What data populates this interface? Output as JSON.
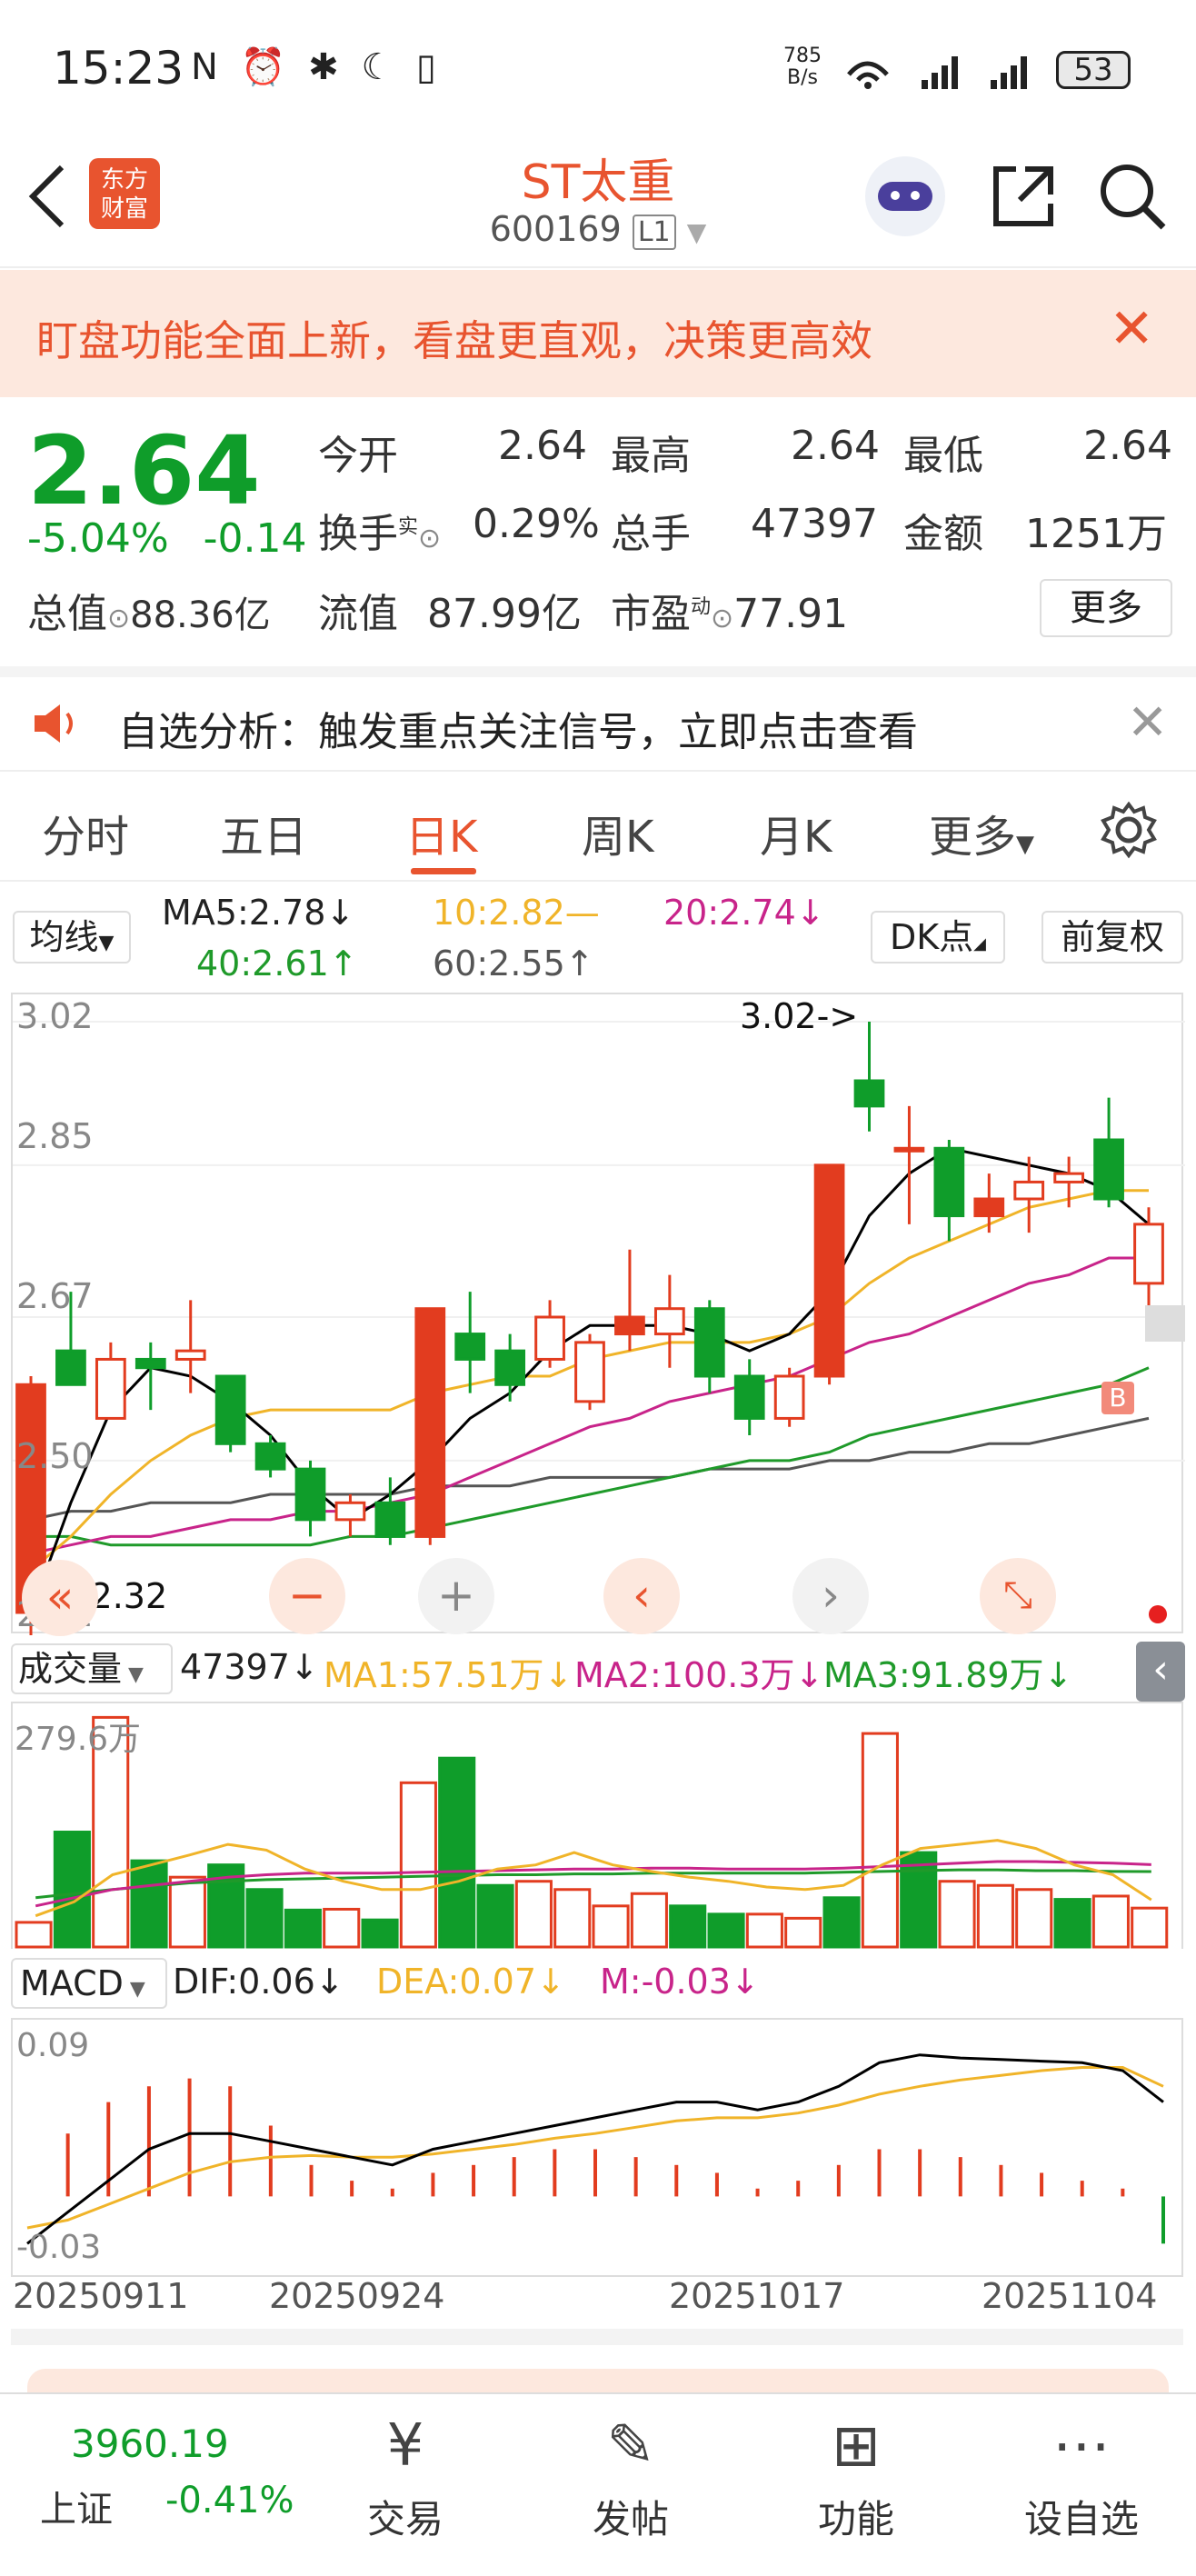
{
  "status_bar": {
    "time": "15:23",
    "icons": "N ⏰ ✱ ☾ ▯",
    "net_speed_value": "785",
    "net_speed_unit": "B/s",
    "battery": "53"
  },
  "header": {
    "brand_line1": "东方",
    "brand_line2": "财富",
    "stock_name": "ST太重",
    "stock_code": "600169",
    "level": "L1"
  },
  "banner": {
    "text": "盯盘功能全面上新，看盘更直观，决策更高效"
  },
  "quote": {
    "price": "2.64",
    "change_pct": "-5.04%",
    "change_amt": "-0.14",
    "open_label": "今开",
    "open": "2.64",
    "high_label": "最高",
    "high": "2.64",
    "low_label": "最低",
    "low": "2.64",
    "turnover_label": "换手",
    "turnover_sup": "实",
    "turnover": "0.29%",
    "volume_label": "总手",
    "volume": "47397",
    "amount_label": "金额",
    "amount": "1251万",
    "mktcap_label": "总值",
    "mktcap": "88.36亿",
    "float_label": "流值",
    "float": "87.99亿",
    "pe_label": "市盈",
    "pe_sup": "动",
    "pe": "77.91",
    "more_label": "更多"
  },
  "notice": {
    "text": "自选分析：触发重点关注信号，立即点击查看"
  },
  "tabs": [
    "分时",
    "五日",
    "日K",
    "周K",
    "月K",
    "更多"
  ],
  "kline": {
    "ma_select": "均线",
    "ma5": "MA5:2.78↓",
    "ma10": "10:2.82—",
    "ma20": "20:2.74↓",
    "ma40": "40:2.61↑",
    "ma60": "60:2.55↑",
    "dk_label": "DK点",
    "fq_label": "前复权",
    "y_labels": [
      "3.02",
      "2.85",
      "2.67",
      "2.50",
      "2.32"
    ],
    "high_marker": "3.02->",
    "low_marker": "<-2.32",
    "b_marker": "B"
  },
  "volume": {
    "select": "成交量",
    "value": "47397↓",
    "ma1": "MA1:57.51万↓",
    "ma2": "MA2:100.3万↓",
    "ma3": "MA3:91.89万↓",
    "top_label": "279.6万"
  },
  "macd": {
    "select": "MACD",
    "dif": "DIF:0.06↓",
    "dea": "DEA:0.07↓",
    "m": "M:-0.03↓",
    "top": "0.09",
    "bottom": "-0.03"
  },
  "dates": [
    "20250911",
    "20250924",
    "20251017",
    "20251104"
  ],
  "colors": {
    "up": "#e23c1f",
    "down": "#0f9d2a",
    "accent": "#e8542f",
    "ma5": "#000000",
    "ma10": "#f0b429",
    "ma20": "#c8248a",
    "ma40": "#1f9a2a",
    "ma60": "#555555"
  },
  "bottom_nav": {
    "index_value": "3960.19",
    "index_name": "上证",
    "index_change": "-0.41%",
    "trade": "交易",
    "post": "发帖",
    "func": "功能",
    "watch": "设自选"
  },
  "chart_data": {
    "type": "candlestick",
    "ylim": [
      2.32,
      3.02
    ],
    "candles": [
      {
        "o": 2.32,
        "c": 2.59,
        "h": 2.6,
        "l": 2.29
      },
      {
        "o": 2.63,
        "c": 2.59,
        "h": 2.7,
        "l": 2.59
      },
      {
        "o": 2.55,
        "c": 2.62,
        "h": 2.64,
        "l": 2.55
      },
      {
        "o": 2.62,
        "c": 2.61,
        "h": 2.64,
        "l": 2.56
      },
      {
        "o": 2.62,
        "c": 2.63,
        "h": 2.69,
        "l": 2.58
      },
      {
        "o": 2.6,
        "c": 2.52,
        "h": 2.6,
        "l": 2.51
      },
      {
        "o": 2.52,
        "c": 2.49,
        "h": 2.53,
        "l": 2.48
      },
      {
        "o": 2.49,
        "c": 2.43,
        "h": 2.5,
        "l": 2.41
      },
      {
        "o": 2.43,
        "c": 2.45,
        "h": 2.46,
        "l": 2.41
      },
      {
        "o": 2.45,
        "c": 2.41,
        "h": 2.48,
        "l": 2.4
      },
      {
        "o": 2.41,
        "c": 2.68,
        "h": 2.68,
        "l": 2.4
      },
      {
        "o": 2.65,
        "c": 2.62,
        "h": 2.7,
        "l": 2.58
      },
      {
        "o": 2.63,
        "c": 2.59,
        "h": 2.65,
        "l": 2.57
      },
      {
        "o": 2.62,
        "c": 2.67,
        "h": 2.69,
        "l": 2.61
      },
      {
        "o": 2.57,
        "c": 2.64,
        "h": 2.65,
        "l": 2.56
      },
      {
        "o": 2.65,
        "c": 2.67,
        "h": 2.75,
        "l": 2.63
      },
      {
        "o": 2.65,
        "c": 2.68,
        "h": 2.72,
        "l": 2.61
      },
      {
        "o": 2.68,
        "c": 2.6,
        "h": 2.69,
        "l": 2.58
      },
      {
        "o": 2.6,
        "c": 2.55,
        "h": 2.62,
        "l": 2.53
      },
      {
        "o": 2.55,
        "c": 2.6,
        "h": 2.61,
        "l": 2.54
      },
      {
        "o": 2.6,
        "c": 2.85,
        "h": 2.85,
        "l": 2.59
      },
      {
        "o": 2.95,
        "c": 2.92,
        "h": 3.02,
        "l": 2.89
      },
      {
        "o": 2.87,
        "c": 2.87,
        "h": 2.92,
        "l": 2.78
      },
      {
        "o": 2.87,
        "c": 2.79,
        "h": 2.88,
        "l": 2.76
      },
      {
        "o": 2.79,
        "c": 2.81,
        "h": 2.84,
        "l": 2.77
      },
      {
        "o": 2.81,
        "c": 2.83,
        "h": 2.86,
        "l": 2.77
      },
      {
        "o": 2.83,
        "c": 2.84,
        "h": 2.86,
        "l": 2.8
      },
      {
        "o": 2.88,
        "c": 2.81,
        "h": 2.93,
        "l": 2.8
      },
      {
        "o": 2.71,
        "c": 2.78,
        "h": 2.8,
        "l": 2.68
      }
    ],
    "ma5": [
      2.32,
      2.45,
      2.56,
      2.61,
      2.6,
      2.57,
      2.53,
      2.47,
      2.43,
      2.46,
      2.5,
      2.55,
      2.58,
      2.63,
      2.66,
      2.66,
      2.66,
      2.65,
      2.63,
      2.65,
      2.7,
      2.79,
      2.84,
      2.87,
      2.86,
      2.85,
      2.84,
      2.82,
      2.78
    ],
    "ma10": [
      2.37,
      2.41,
      2.46,
      2.5,
      2.53,
      2.55,
      2.56,
      2.56,
      2.56,
      2.56,
      2.58,
      2.59,
      2.6,
      2.6,
      2.62,
      2.63,
      2.64,
      2.64,
      2.64,
      2.65,
      2.67,
      2.71,
      2.74,
      2.76,
      2.78,
      2.8,
      2.81,
      2.82,
      2.82
    ],
    "ma20": [
      2.39,
      2.4,
      2.41,
      2.41,
      2.42,
      2.43,
      2.43,
      2.44,
      2.44,
      2.45,
      2.46,
      2.48,
      2.5,
      2.52,
      2.54,
      2.55,
      2.57,
      2.58,
      2.59,
      2.6,
      2.62,
      2.64,
      2.65,
      2.67,
      2.69,
      2.71,
      2.72,
      2.74,
      2.74
    ],
    "ma40": [
      2.41,
      2.41,
      2.4,
      2.4,
      2.4,
      2.4,
      2.4,
      2.4,
      2.41,
      2.41,
      2.42,
      2.43,
      2.44,
      2.45,
      2.46,
      2.47,
      2.48,
      2.49,
      2.5,
      2.5,
      2.51,
      2.53,
      2.54,
      2.55,
      2.56,
      2.57,
      2.58,
      2.59,
      2.61
    ],
    "ma60": [
      2.43,
      2.44,
      2.44,
      2.45,
      2.45,
      2.45,
      2.46,
      2.46,
      2.46,
      2.46,
      2.47,
      2.47,
      2.47,
      2.48,
      2.48,
      2.48,
      2.48,
      2.49,
      2.49,
      2.49,
      2.5,
      2.5,
      2.51,
      2.51,
      2.52,
      2.52,
      2.53,
      2.54,
      2.55
    ],
    "volume": [
      30,
      140,
      279.6,
      105,
      85,
      100,
      70,
      45,
      46,
      33,
      200,
      230,
      75,
      80,
      70,
      50,
      65,
      50,
      40,
      40,
      35,
      60,
      260,
      115,
      80,
      75,
      70,
      58,
      62,
      47.4
    ],
    "vol_ma1": [
      38,
      55,
      88,
      100,
      112,
      125,
      118,
      95,
      80,
      70,
      70,
      80,
      95,
      100,
      115,
      100,
      92,
      85,
      80,
      73,
      70,
      75,
      100,
      120,
      125,
      130,
      120,
      100,
      88,
      57.5
    ],
    "vol_ma2": [
      50,
      60,
      70,
      75,
      80,
      85,
      88,
      90,
      90,
      90,
      91,
      92,
      93,
      94,
      95,
      95,
      96,
      96,
      95,
      95,
      95,
      96,
      98,
      100,
      102,
      104,
      104,
      103,
      102,
      100.3
    ],
    "vol_ma3": [
      60,
      65,
      70,
      74,
      78,
      80,
      82,
      83,
      84,
      85,
      86,
      87,
      88,
      88,
      89,
      89,
      90,
      90,
      90,
      90,
      90,
      91,
      92,
      93,
      94,
      94,
      93,
      93,
      92,
      91.89
    ],
    "dif": [
      -0.03,
      -0.01,
      0.01,
      0.03,
      0.04,
      0.04,
      0.035,
      0.03,
      0.025,
      0.02,
      0.03,
      0.035,
      0.04,
      0.045,
      0.05,
      0.055,
      0.06,
      0.06,
      0.055,
      0.06,
      0.07,
      0.085,
      0.09,
      0.088,
      0.087,
      0.086,
      0.085,
      0.08,
      0.06
    ],
    "dea": [
      -0.02,
      -0.015,
      -0.005,
      0.005,
      0.015,
      0.022,
      0.025,
      0.026,
      0.025,
      0.025,
      0.027,
      0.03,
      0.033,
      0.037,
      0.04,
      0.044,
      0.048,
      0.05,
      0.05,
      0.053,
      0.058,
      0.065,
      0.07,
      0.074,
      0.077,
      0.08,
      0.082,
      0.082,
      0.07
    ],
    "macd_hist": [
      0.0,
      0.04,
      0.06,
      0.07,
      0.075,
      0.07,
      0.045,
      0.02,
      0.01,
      0.005,
      0.015,
      0.02,
      0.025,
      0.03,
      0.03,
      0.025,
      0.02,
      0.015,
      0.005,
      0.01,
      0.02,
      0.03,
      0.03,
      0.025,
      0.02,
      0.015,
      0.01,
      0.005,
      -0.03
    ]
  }
}
